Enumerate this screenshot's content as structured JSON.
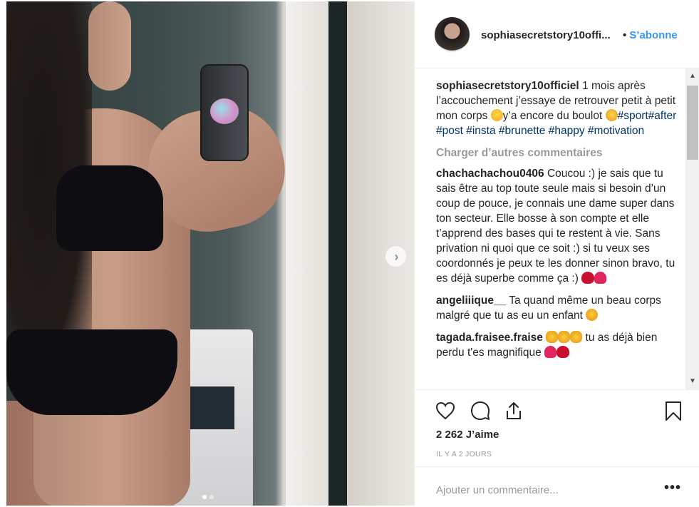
{
  "post": {
    "username": "sophiasecretstory10offi...",
    "follow_label": "S’abonne",
    "follow_separator": "•"
  },
  "caption": {
    "username": "sophiasecretstory10officiel",
    "text_1": " 1 mois après l’accouchement j’essaye de retrouver petit à petit mon corps ",
    "text_2": "y’a encore du boulot ",
    "tags": [
      "#sport",
      "#after",
      "#post",
      "#insta",
      "#brunette",
      "#happy",
      "#motivation"
    ]
  },
  "load_more": "Charger d’autres commentaires",
  "comments": [
    {
      "username": "chachachachou0406",
      "text": " Coucou :) je sais que tu sais être au top toute seule mais si besoin d’un coup de pouce, je connais une dame super dans ton secteur. Elle bosse à son compte et elle t’apprend des bases qui te restent à vie. Sans privation ni quoi que ce soit :) si tu veux ses coordonnés je peux te les donner sinon bravo, tu es déjà superbe comme ça :) "
    },
    {
      "username": "angeliiique__",
      "text": " Ta quand même un beau corps malgré que tu as eu un enfant "
    },
    {
      "username": "tagada.fraisee.fraise",
      "text_after": " tu as déjà bien perdu t'es magnifique "
    }
  ],
  "likes": "2 262 J’aime",
  "timestamp": "IL Y A 2 JOURS",
  "add_comment_placeholder": "Ajouter un commentaire...",
  "more_options": "•••",
  "next_arrow": "›",
  "scrollbar": {
    "up": "▲",
    "down": "▼"
  },
  "icons": [
    "heart-icon",
    "comment-icon",
    "share-icon",
    "bookmark-icon"
  ],
  "colors": {
    "link": "#3897f0",
    "hashtag": "#003569",
    "muted": "#999999",
    "text": "#262626"
  }
}
